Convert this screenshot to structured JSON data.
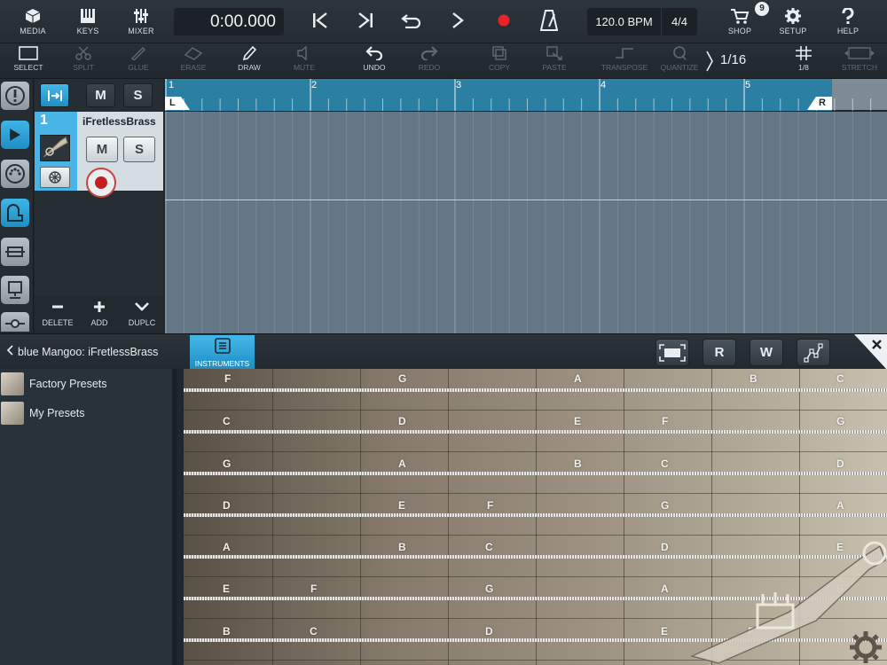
{
  "topbar": {
    "media": "MEDIA",
    "keys": "KEYS",
    "mixer": "MIXER",
    "time": "0:00.000",
    "tempo": "120.0 BPM",
    "signature": "4/4",
    "shop": "SHOP",
    "shop_badge": "9",
    "setup": "SETUP",
    "help": "HELP"
  },
  "editbar": {
    "select": "SELECT",
    "split": "SPLIT",
    "glue": "GLUE",
    "erase": "ERASE",
    "draw": "DRAW",
    "mute": "MUTE",
    "undo": "UNDO",
    "redo": "REDO",
    "copy": "COPY",
    "paste": "PASTE",
    "transpose": "TRANSPOSE",
    "quantize": "QUANTIZE",
    "quantize_value": "1/16",
    "grid_value": "1/8",
    "stretch": "STRETCH"
  },
  "trackhead": {
    "mute_label": "M",
    "solo_label": "S",
    "track_number": "1",
    "track_name": "iFretlessBrass",
    "delete": "DELETE",
    "add": "ADD",
    "duplicate": "DUPLC"
  },
  "ruler": {
    "bars": [
      "1",
      "2",
      "3",
      "4",
      "5"
    ],
    "loop_left": "L",
    "loop_right": "R"
  },
  "instrument": {
    "title": "blue Mangoo: iFretlessBrass",
    "tab_label": "INSTRUMENTS",
    "r_button": "R",
    "w_button": "W"
  },
  "presets": [
    {
      "label": "Factory Presets"
    },
    {
      "label": "My Presets"
    }
  ],
  "fretboard": {
    "strings": [
      {
        "notes": [
          "F",
          "G",
          "A",
          "B",
          "C"
        ]
      },
      {
        "notes": [
          "C",
          "D",
          "E",
          "F",
          "G"
        ]
      },
      {
        "notes": [
          "G",
          "A",
          "B",
          "C",
          "D"
        ]
      },
      {
        "notes": [
          "D",
          "E",
          "F",
          "G",
          "A"
        ]
      },
      {
        "notes": [
          "A",
          "B",
          "C",
          "D",
          "E"
        ]
      },
      {
        "notes": [
          "E",
          "F",
          "G",
          "A",
          "B"
        ]
      },
      {
        "notes": [
          "B",
          "C",
          "D",
          "E",
          "F"
        ]
      }
    ]
  },
  "colors": {
    "accent": "#3fb4e6",
    "record": "#e8232a",
    "loop_range": "#2b7fa3"
  }
}
